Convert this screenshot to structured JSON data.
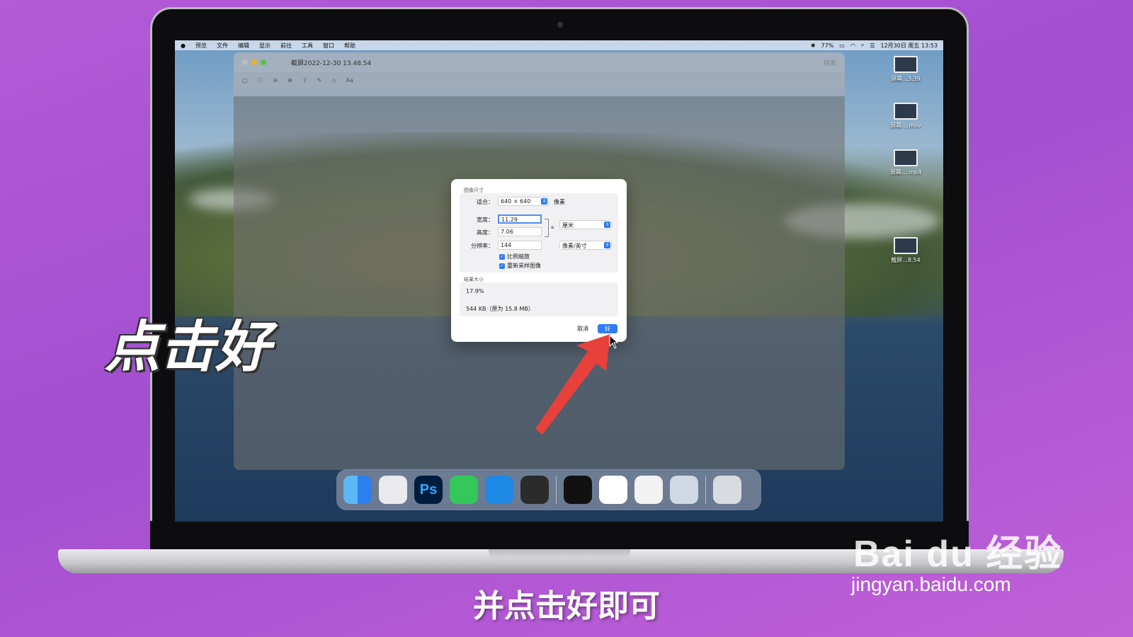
{
  "menubar": {
    "apple": "",
    "items": [
      "预览",
      "文件",
      "编辑",
      "显示",
      "前往",
      "工具",
      "窗口",
      "帮助"
    ],
    "battery": "77%",
    "datetime": "12月30日 周五 13:53"
  },
  "desktop_icons": [
    "屏幕...3.39",
    "屏幕....mov",
    "屏幕....mp4",
    "截屏...8.54"
  ],
  "window": {
    "title": "截屏2022-12-30 13.48.54",
    "search_placeholder": "搜索"
  },
  "dialog": {
    "section_image_size": "图像尺寸",
    "fit_label": "适合：",
    "fit_value": "640 × 640",
    "fit_unit": "像素",
    "width_label": "宽度：",
    "width_value": "11.29",
    "height_label": "高度：",
    "height_value": "7.06",
    "resolution_label": "分辨率：",
    "resolution_value": "144",
    "size_unit": "厘米",
    "resolution_unit": "像素/英寸",
    "scale_proportionally": "比例缩放",
    "resample_image": "重新采样图像",
    "section_result": "结果大小",
    "result_percent": "17.9%",
    "result_size": "544 KB（原为 15.8 MB）",
    "cancel_label": "取消",
    "ok_label": "好"
  },
  "dock": {
    "apps": [
      "finder-icon",
      "launchpad-icon",
      "photoshop-icon",
      "messages-icon",
      "safari-icon",
      "quicktime-icon",
      "activity-monitor-icon",
      "notes-icon",
      "mail-icon",
      "preview-icon",
      "trash-icon"
    ],
    "photoshop_label": "Ps"
  },
  "overlay": {
    "big_caption": "点击好",
    "subtitle": "并点击好即可"
  },
  "watermark": {
    "logo": "Bai du 经验",
    "url": "jingyan.baidu.com"
  },
  "colors": {
    "background": "#b35ad6",
    "accent": "#2f7cf6",
    "arrow": "#e8403a"
  }
}
